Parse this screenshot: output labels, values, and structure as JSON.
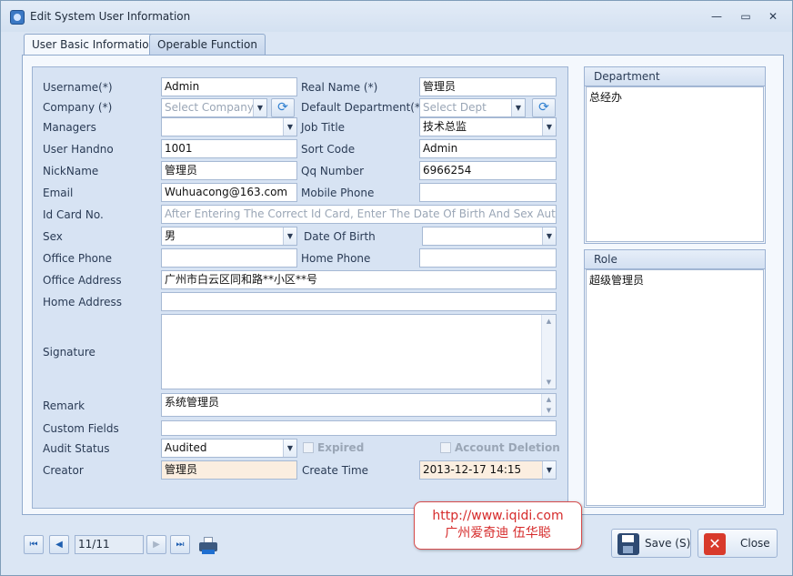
{
  "window": {
    "title": "Edit System User Information",
    "minimize": "—",
    "restore": "▭",
    "close": "✕"
  },
  "tabs": [
    {
      "label": "User Basic Information"
    },
    {
      "label": "Operable Function"
    }
  ],
  "form": {
    "username_label": "Username(*)",
    "username_value": "Admin",
    "real_name_label": "Real Name (*)",
    "real_name_value": "管理员",
    "company_label": "Company (*)",
    "company_placeholder": "Select Company",
    "default_dept_label": "Default Department(*)",
    "default_dept_placeholder": "Select Dept",
    "managers_label": "Managers",
    "managers_value": "",
    "job_title_label": "Job Title",
    "job_title_value": "技术总监",
    "handno_label": "User Handno",
    "handno_value": "1001",
    "sort_code_label": "Sort Code",
    "sort_code_value": "Admin",
    "nickname_label": "NickName",
    "nickname_value": "管理员",
    "qq_label": "Qq Number",
    "qq_value": "6966254",
    "email_label": "Email",
    "email_value": "Wuhuacong@163.com",
    "mobile_label": "Mobile Phone",
    "mobile_value": "",
    "idcard_label": "Id Card No.",
    "idcard_placeholder": "After Entering The Correct Id Card, Enter The Date Of Birth And Sex Automa",
    "sex_label": "Sex",
    "sex_value": "男",
    "dob_label": "Date Of Birth",
    "dob_value": "",
    "office_phone_label": "Office Phone",
    "office_phone_value": "",
    "home_phone_label": "Home Phone",
    "home_phone_value": "",
    "office_address_label": "Office Address",
    "office_address_value": "广州市白云区同和路**小区**号",
    "home_address_label": "Home Address",
    "home_address_value": "",
    "signature_label": "Signature",
    "signature_value": "",
    "remark_label": "Remark",
    "remark_value": "系统管理员",
    "custom_fields_label": "Custom Fields",
    "custom_fields_value": "",
    "audit_status_label": "Audit Status",
    "audit_status_value": "Audited",
    "expired_label": "Expired",
    "account_deletion_label": "Account Deletion",
    "creator_label": "Creator",
    "creator_value": "管理员",
    "create_time_label": "Create Time",
    "create_time_value": "2013-12-17 14:15"
  },
  "department": {
    "header": "Department",
    "items": [
      "总经办"
    ]
  },
  "role": {
    "header": "Role",
    "items": [
      "超级管理员"
    ]
  },
  "nav": {
    "page_info": "11/11",
    "first": "⏮",
    "prev": "◀",
    "next": "▶",
    "last": "⏭"
  },
  "watermark": {
    "line1": "http://www.iqidi.com",
    "line2": "广州爱奇迪 伍华聪"
  },
  "buttons": {
    "save": "Save (S)",
    "close": "Close"
  },
  "icons": {
    "refresh": "refresh-icon",
    "printer": "printer-icon",
    "save": "save-icon",
    "close": "close-icon"
  },
  "colors": {
    "accent": "#3b78c4",
    "readonly_bg": "#fbeee0",
    "watermark_red": "#d62b2b"
  }
}
